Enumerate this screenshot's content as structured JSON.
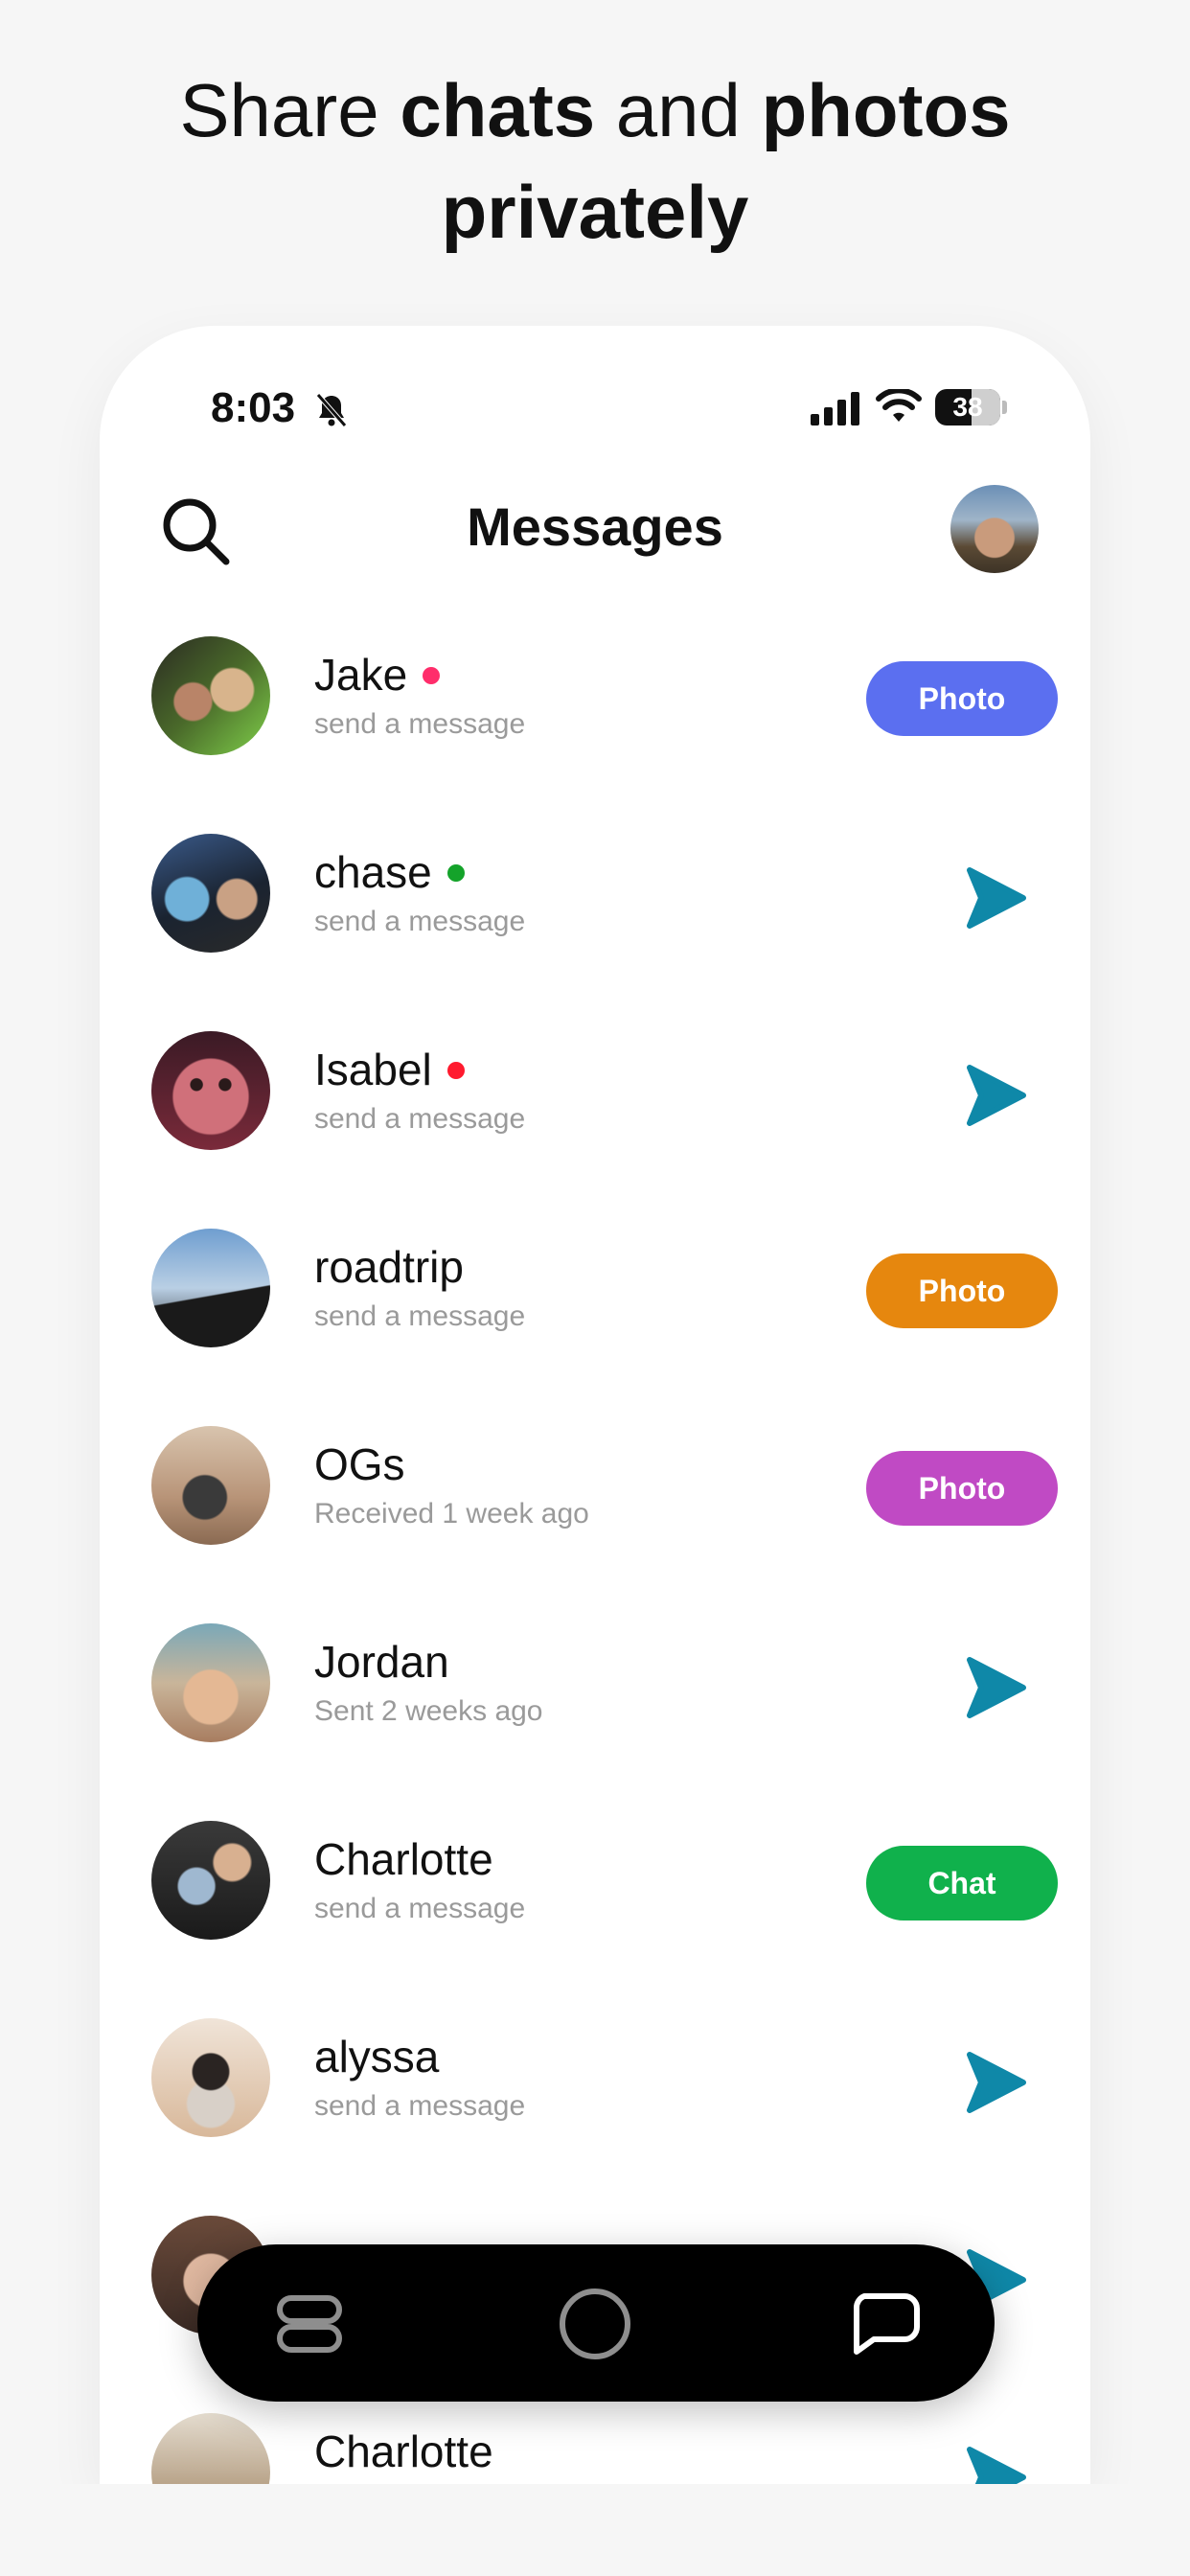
{
  "headline": {
    "part1": "Share ",
    "bold1": "chats",
    "part2": " and ",
    "bold2": "photos",
    "bold3": "privately"
  },
  "status_bar": {
    "time": "8:03",
    "battery": "38",
    "icons": [
      "bell-slash-icon",
      "cellular-signal-icon",
      "wifi-icon",
      "battery-icon"
    ]
  },
  "header": {
    "title": "Messages",
    "search_icon": "search-icon",
    "profile_avatar": "profile-avatar"
  },
  "conversations": [
    {
      "name": "Jake",
      "subtitle": "send a message",
      "dot_color": "#ff2d6b",
      "action": "Photo",
      "action_color": "#5b6ff0"
    },
    {
      "name": "chase",
      "subtitle": "send a message",
      "dot_color": "#14a32a",
      "action": "send",
      "action_color": "#0f88a8"
    },
    {
      "name": "Isabel",
      "subtitle": "send a message",
      "dot_color": "#ff1a2e",
      "action": "send",
      "action_color": "#0f88a8"
    },
    {
      "name": "roadtrip",
      "subtitle": "send a message",
      "dot_color": null,
      "action": "Photo",
      "action_color": "#e6870e"
    },
    {
      "name": "OGs",
      "subtitle": "Received 1 week ago",
      "dot_color": null,
      "action": "Photo",
      "action_color": "#c04ac4"
    },
    {
      "name": "Jordan",
      "subtitle": "Sent 2 weeks ago",
      "dot_color": null,
      "action": "send",
      "action_color": "#0f88a8"
    },
    {
      "name": "Charlotte",
      "subtitle": "send a message",
      "dot_color": null,
      "action": "Chat",
      "action_color": "#10b14c"
    },
    {
      "name": "alyssa",
      "subtitle": "send a message",
      "dot_color": null,
      "action": "send",
      "action_color": "#0f88a8"
    },
    {
      "name": "",
      "subtitle": "",
      "dot_color": null,
      "action": "send",
      "action_color": "#0f88a8"
    },
    {
      "name": "Charlotte",
      "subtitle": "",
      "dot_color": null,
      "action": "send",
      "action_color": "#0f88a8"
    }
  ],
  "bottom_nav": {
    "items": [
      "stack-icon",
      "camera-shutter-icon",
      "chat-bubble-icon"
    ]
  },
  "colors": {
    "send_arrow": "#0f88a8",
    "nav_icon": "#8e8e8e"
  }
}
